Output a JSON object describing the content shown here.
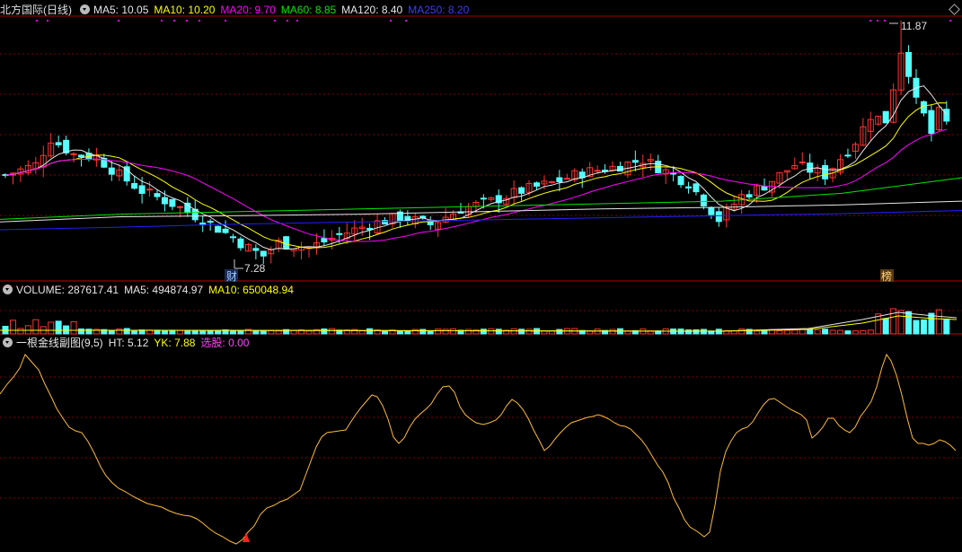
{
  "colors": {
    "up": "#ff3232",
    "down": "#54ffff",
    "ma5": "#e6e6e6",
    "ma10": "#ffff00",
    "ma20": "#ff00ff",
    "ma60": "#00e600",
    "ma120": "#e6e6e6",
    "ma250": "#2020ff",
    "grid": "#800000",
    "ht": "#ffbb33"
  },
  "main_header": {
    "title": "北方国际(日线)",
    "ma5": "MA5: 10.05",
    "ma10": "MA10: 10.20",
    "ma20": "MA20: 9.70",
    "ma60": "MA60: 8.85",
    "ma120": "MA120: 8.40",
    "ma250": "MA250: 8.20"
  },
  "volume_header": {
    "label": "VOLUME: 287617.41",
    "ma5": "MA5: 494874.97",
    "ma10": "MA10: 650048.94"
  },
  "indicator_header": {
    "name": "一根金线副图(9,5)",
    "ht": "HT: 5.12",
    "yk": "YK: 7.88",
    "pick": "选股: 0.00"
  },
  "chart_data": [
    {
      "type": "candlestick",
      "title": "北方国际(日线)",
      "annotations": [
        {
          "text": "7.28",
          "kind": "low"
        },
        {
          "text": "11.87",
          "kind": "high"
        },
        {
          "text": "财",
          "kind": "marker"
        },
        {
          "text": "榜",
          "kind": "marker"
        }
      ],
      "ma_last": {
        "MA5": 10.05,
        "MA10": 10.2,
        "MA20": 9.7,
        "MA60": 8.85,
        "MA120": 8.4,
        "MA250": 8.2
      },
      "high": 11.87,
      "low": 7.28,
      "candle_count": 125
    },
    {
      "type": "bar",
      "title": "VOLUME",
      "last": 287617.41,
      "ma5": 494874.97,
      "ma10": 650048.94
    },
    {
      "type": "line",
      "title": "一根金线副图(9,5)",
      "series": [
        {
          "name": "HT",
          "last": 5.12
        },
        {
          "name": "YK",
          "last": 7.88
        }
      ],
      "ht_points": [
        [
          0,
          439
        ],
        [
          8,
          428
        ],
        [
          15,
          420
        ],
        [
          22,
          410
        ],
        [
          28,
          395
        ],
        [
          35,
          403
        ],
        [
          43,
          412
        ],
        [
          50,
          428
        ],
        [
          57,
          442
        ],
        [
          63,
          455
        ],
        [
          70,
          466
        ],
        [
          77,
          476
        ],
        [
          84,
          480
        ],
        [
          91,
          482
        ],
        [
          98,
          492
        ],
        [
          105,
          505
        ],
        [
          112,
          520
        ],
        [
          118,
          530
        ],
        [
          125,
          538
        ],
        [
          132,
          544
        ],
        [
          140,
          548
        ],
        [
          148,
          553
        ],
        [
          156,
          557
        ],
        [
          164,
          561
        ],
        [
          172,
          563
        ],
        [
          180,
          565
        ],
        [
          188,
          569
        ],
        [
          196,
          572
        ],
        [
          204,
          574
        ],
        [
          212,
          575
        ],
        [
          219,
          578
        ],
        [
          226,
          583
        ],
        [
          233,
          589
        ],
        [
          240,
          594
        ],
        [
          248,
          598
        ],
        [
          256,
          603
        ],
        [
          263,
          606
        ],
        [
          270,
          601
        ],
        [
          276,
          593
        ],
        [
          283,
          586
        ],
        [
          290,
          573
        ],
        [
          297,
          566
        ],
        [
          305,
          563
        ],
        [
          312,
          559
        ],
        [
          320,
          556
        ],
        [
          327,
          551
        ],
        [
          334,
          546
        ],
        [
          340,
          530
        ],
        [
          346,
          514
        ],
        [
          352,
          498
        ],
        [
          358,
          487
        ],
        [
          364,
          482
        ],
        [
          371,
          481
        ],
        [
          378,
          480
        ],
        [
          385,
          479
        ],
        [
          390,
          471
        ],
        [
          396,
          462
        ],
        [
          402,
          454
        ],
        [
          408,
          447
        ],
        [
          414,
          440
        ],
        [
          420,
          442
        ],
        [
          426,
          452
        ],
        [
          432,
          467
        ],
        [
          438,
          487
        ],
        [
          444,
          494
        ],
        [
          450,
          488
        ],
        [
          456,
          476
        ],
        [
          462,
          467
        ],
        [
          468,
          461
        ],
        [
          474,
          456
        ],
        [
          480,
          450
        ],
        [
          486,
          440
        ],
        [
          493,
          431
        ],
        [
          500,
          430
        ],
        [
          506,
          437
        ],
        [
          512,
          453
        ],
        [
          518,
          462
        ],
        [
          524,
          467
        ],
        [
          530,
          471
        ],
        [
          538,
          473
        ],
        [
          545,
          471
        ],
        [
          552,
          468
        ],
        [
          558,
          462
        ],
        [
          564,
          452
        ],
        [
          570,
          445
        ],
        [
          576,
          449
        ],
        [
          582,
          456
        ],
        [
          588,
          466
        ],
        [
          594,
          479
        ],
        [
          600,
          490
        ],
        [
          606,
          502
        ],
        [
          612,
          497
        ],
        [
          618,
          489
        ],
        [
          624,
          482
        ],
        [
          630,
          476
        ],
        [
          636,
          471
        ],
        [
          642,
          469
        ],
        [
          648,
          467
        ],
        [
          654,
          465
        ],
        [
          660,
          464
        ],
        [
          666,
          462
        ],
        [
          672,
          464
        ],
        [
          678,
          467
        ],
        [
          684,
          471
        ],
        [
          690,
          474
        ],
        [
          696,
          475
        ],
        [
          702,
          478
        ],
        [
          708,
          484
        ],
        [
          714,
          490
        ],
        [
          720,
          498
        ],
        [
          726,
          508
        ],
        [
          732,
          518
        ],
        [
          738,
          526
        ],
        [
          744,
          538
        ],
        [
          750,
          555
        ],
        [
          756,
          566
        ],
        [
          762,
          579
        ],
        [
          768,
          587
        ],
        [
          776,
          592
        ],
        [
          784,
          598
        ],
        [
          790,
          593
        ],
        [
          796,
          563
        ],
        [
          802,
          525
        ],
        [
          808,
          503
        ],
        [
          814,
          491
        ],
        [
          820,
          482
        ],
        [
          826,
          478
        ],
        [
          832,
          476
        ],
        [
          838,
          470
        ],
        [
          844,
          460
        ],
        [
          850,
          451
        ],
        [
          856,
          445
        ],
        [
          862,
          444
        ],
        [
          868,
          448
        ],
        [
          874,
          452
        ],
        [
          880,
          456
        ],
        [
          886,
          459
        ],
        [
          892,
          462
        ],
        [
          898,
          468
        ],
        [
          904,
          488
        ],
        [
          910,
          483
        ],
        [
          916,
          476
        ],
        [
          922,
          466
        ],
        [
          928,
          466
        ],
        [
          934,
          474
        ],
        [
          940,
          479
        ],
        [
          946,
          482
        ],
        [
          952,
          476
        ],
        [
          958,
          464
        ],
        [
          964,
          456
        ],
        [
          970,
          447
        ],
        [
          976,
          431
        ],
        [
          982,
          409
        ],
        [
          987,
          395
        ],
        [
          992,
          402
        ],
        [
          998,
          418
        ],
        [
          1004,
          440
        ],
        [
          1010,
          466
        ],
        [
          1016,
          488
        ],
        [
          1022,
          494
        ],
        [
          1028,
          494
        ],
        [
          1034,
          496
        ],
        [
          1040,
          494
        ],
        [
          1046,
          490
        ],
        [
          1052,
          492
        ],
        [
          1058,
          496
        ],
        [
          1064,
          502
        ]
      ]
    }
  ]
}
